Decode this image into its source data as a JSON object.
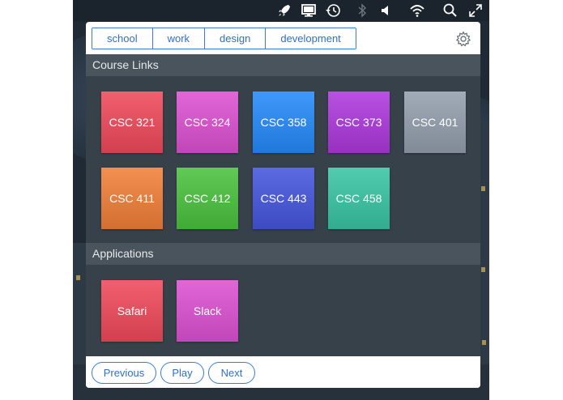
{
  "tabs": [
    {
      "label": "school"
    },
    {
      "label": "work"
    },
    {
      "label": "design"
    },
    {
      "label": "development"
    }
  ],
  "menubar": {
    "icons": [
      "rocket-icon",
      "display-icon",
      "time-machine-icon",
      "bluetooth-icon",
      "volume-icon",
      "wifi-icon",
      "search-icon",
      "fullscreen-icon"
    ]
  },
  "sections": {
    "course_links": {
      "title": "Course Links",
      "tiles": [
        {
          "label": "CSC 321",
          "color": "#e04e5e"
        },
        {
          "label": "CSC 324",
          "color": "#cf55c6"
        },
        {
          "label": "CSC 358",
          "color": "#2e87e8"
        },
        {
          "label": "CSC 373",
          "color": "#a63fcf"
        },
        {
          "label": "CSC 401",
          "color": "#8f99a6"
        },
        {
          "label": "CSC 411",
          "color": "#e07d3f"
        },
        {
          "label": "CSC 412",
          "color": "#4fb845"
        },
        {
          "label": "CSC 443",
          "color": "#4a59cf"
        },
        {
          "label": "CSC 458",
          "color": "#3fba9c"
        }
      ]
    },
    "applications": {
      "title": "Applications",
      "tiles": [
        {
          "label": "Safari",
          "color": "#e04e5e"
        },
        {
          "label": "Slack",
          "color": "#cf55c6"
        }
      ]
    }
  },
  "footer": {
    "previous": "Previous",
    "play": "Play",
    "next": "Next"
  },
  "colors": {
    "accent": "#3a7bd5",
    "panel": "#37414a",
    "section_bar": "#4a545c"
  }
}
